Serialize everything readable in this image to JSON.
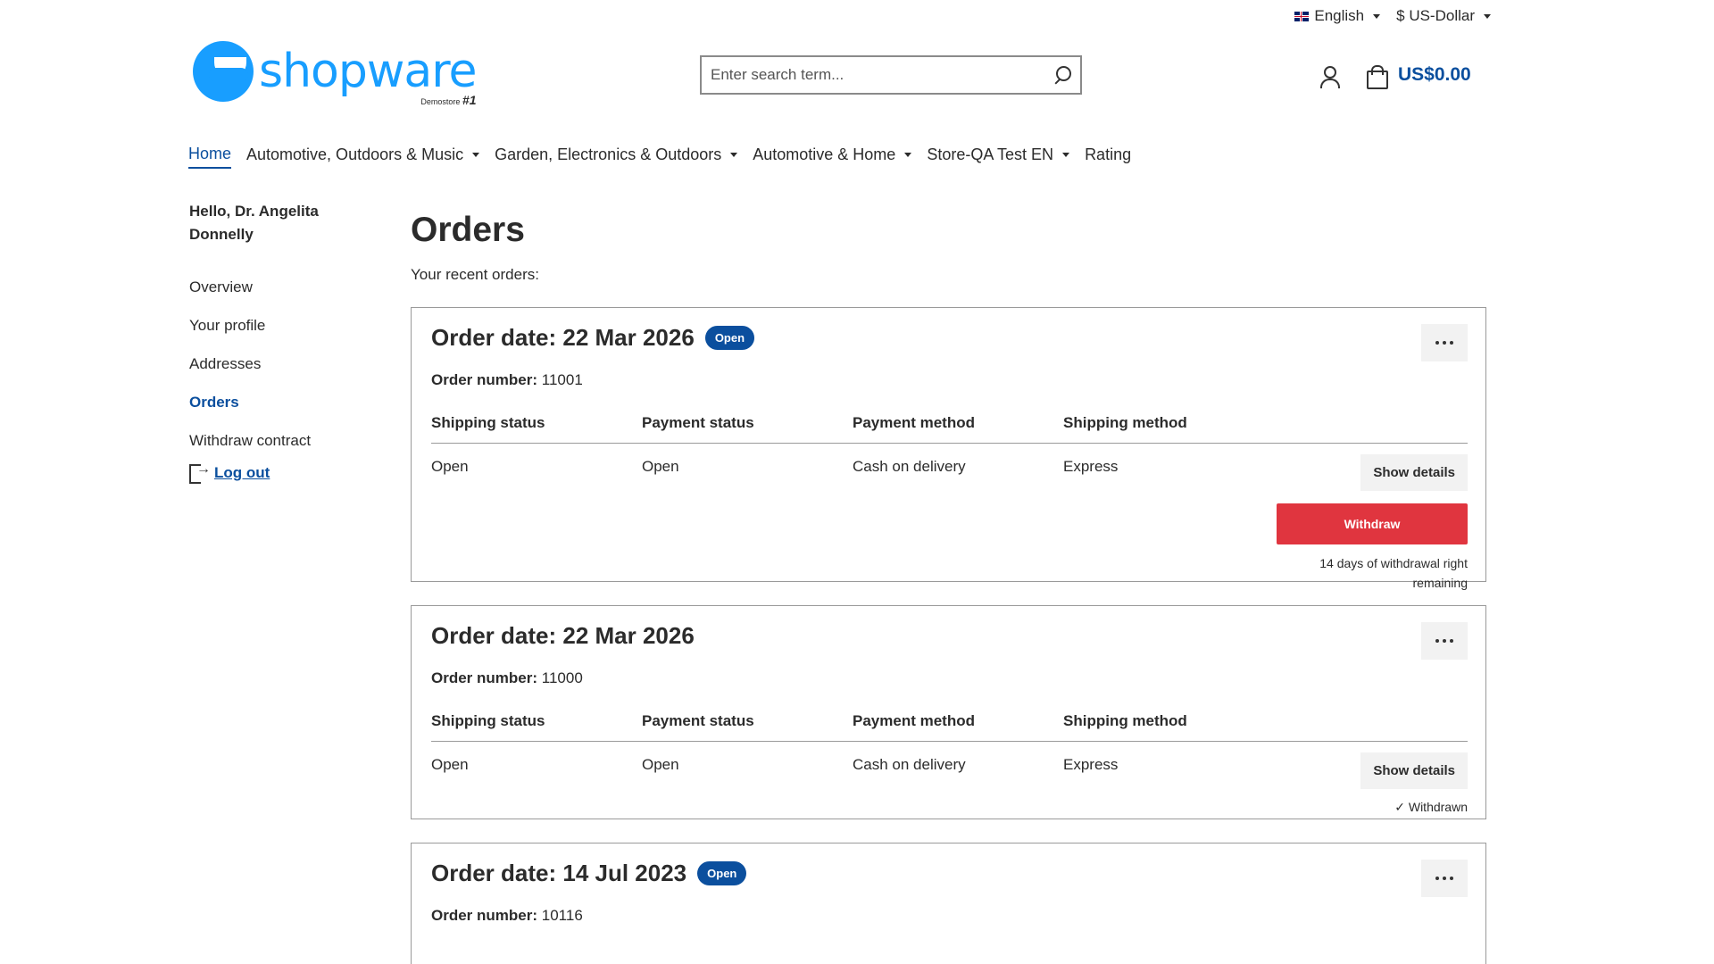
{
  "topbar": {
    "language": "English",
    "currency": "$ US-Dollar"
  },
  "header": {
    "logo_text": "shopware",
    "logo_sub": "Demostore",
    "logo_badge": "#1",
    "search_placeholder": "Enter search term...",
    "cart_total": "US$0.00"
  },
  "nav": {
    "items": [
      {
        "label": "Home",
        "active": true,
        "dropdown": false
      },
      {
        "label": "Automotive, Outdoors & Music",
        "dropdown": true
      },
      {
        "label": "Garden, Electronics & Outdoors",
        "dropdown": true
      },
      {
        "label": "Automotive & Home",
        "dropdown": true
      },
      {
        "label": "Store-QA Test EN",
        "dropdown": true
      },
      {
        "label": "Rating",
        "dropdown": false
      }
    ]
  },
  "sidebar": {
    "greeting": "Hello, Dr. Angelita Donnelly",
    "items": [
      {
        "label": "Overview"
      },
      {
        "label": "Your profile"
      },
      {
        "label": "Addresses"
      },
      {
        "label": "Orders",
        "active": true
      },
      {
        "label": "Withdraw contract"
      }
    ],
    "logout": "Log out"
  },
  "main": {
    "title": "Orders",
    "subtitle": "Your recent orders:",
    "labels": {
      "order_number": "Order number:",
      "shipping_status": "Shipping status",
      "payment_status": "Payment status",
      "payment_method": "Payment method",
      "shipping_method": "Shipping method",
      "show_details": "Show details",
      "withdraw": "Withdraw"
    },
    "orders": [
      {
        "date": "Order date: 22 Mar 2026",
        "badge": "Open",
        "number": "11001",
        "shipping_status": "Open",
        "payment_status": "Open",
        "payment_method": "Cash on delivery",
        "shipping_method": "Express",
        "withdraw_note": "14 days of withdrawal right remaining"
      },
      {
        "date": "Order date: 22 Mar 2026",
        "number": "11000",
        "shipping_status": "Open",
        "payment_status": "Open",
        "payment_method": "Cash on delivery",
        "shipping_method": "Express",
        "withdrawn_note": "✓ Withdrawn"
      },
      {
        "date": "Order date: 14 Jul 2023",
        "badge": "Open",
        "number": "10116"
      }
    ]
  },
  "colors": {
    "brand": "#189eff",
    "primary": "#0b4f9e",
    "danger": "#e0353f"
  }
}
